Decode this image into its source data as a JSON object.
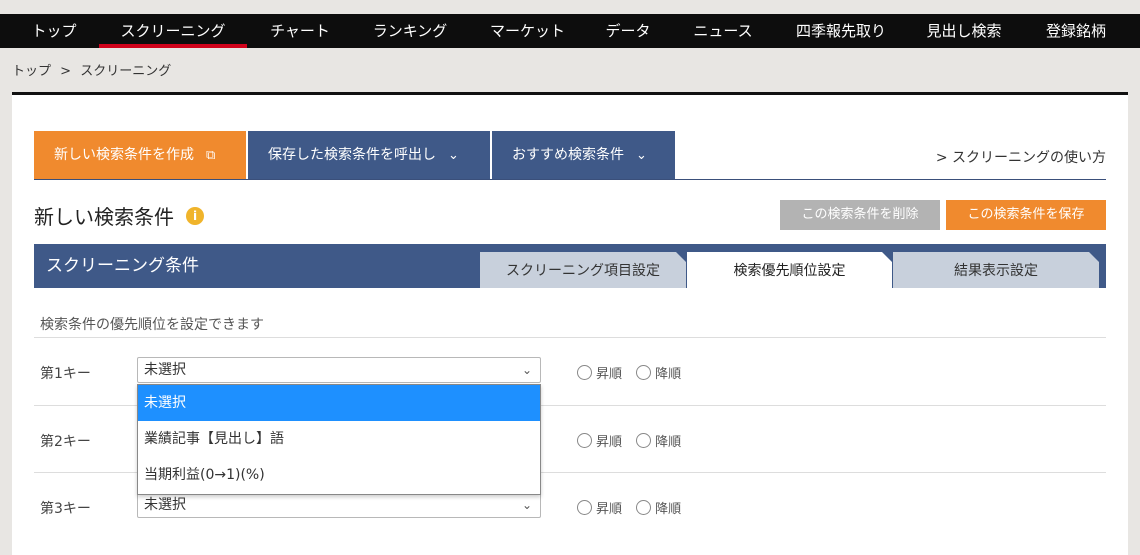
{
  "nav": {
    "items": [
      "トップ",
      "スクリーニング",
      "チャート",
      "ランキング",
      "マーケット",
      "データ",
      "ニュース",
      "四季報先取り",
      "見出し検索",
      "登録銘柄"
    ],
    "active_index": 1
  },
  "breadcrumb": {
    "home": "トップ",
    "sep": ">",
    "current": "スクリーニング"
  },
  "actions": {
    "new": "新しい検索条件を作成",
    "saved": "保存した検索条件を呼出し",
    "recommended": "おすすめ検索条件",
    "howto": "> スクリーニングの使い方"
  },
  "title": "新しい検索条件",
  "buttons": {
    "delete": "この検索条件を削除",
    "save": "この検索条件を保存"
  },
  "screening": {
    "title": "スクリーニング条件",
    "tabs": [
      "スクリーニング項目設定",
      "検索優先順位設定",
      "結果表示設定"
    ],
    "active_tab": 1
  },
  "description": "検索条件の優先順位を設定できます",
  "keys": [
    {
      "label": "第1キー",
      "value": "未選択",
      "asc": "昇順",
      "desc": "降順"
    },
    {
      "label": "第2キー",
      "value": "",
      "asc": "昇順",
      "desc": "降順"
    },
    {
      "label": "第3キー",
      "value": "未選択",
      "asc": "昇順",
      "desc": "降順"
    }
  ],
  "dropdown": {
    "options": [
      "未選択",
      "業績記事【見出し】語",
      "当期利益(0→1)(%)"
    ],
    "selected_index": 0
  },
  "colors": {
    "orange": "#f08a2e",
    "navy": "#3f5988",
    "gray_btn": "#b3b3b3",
    "highlight": "#1e90ff"
  }
}
